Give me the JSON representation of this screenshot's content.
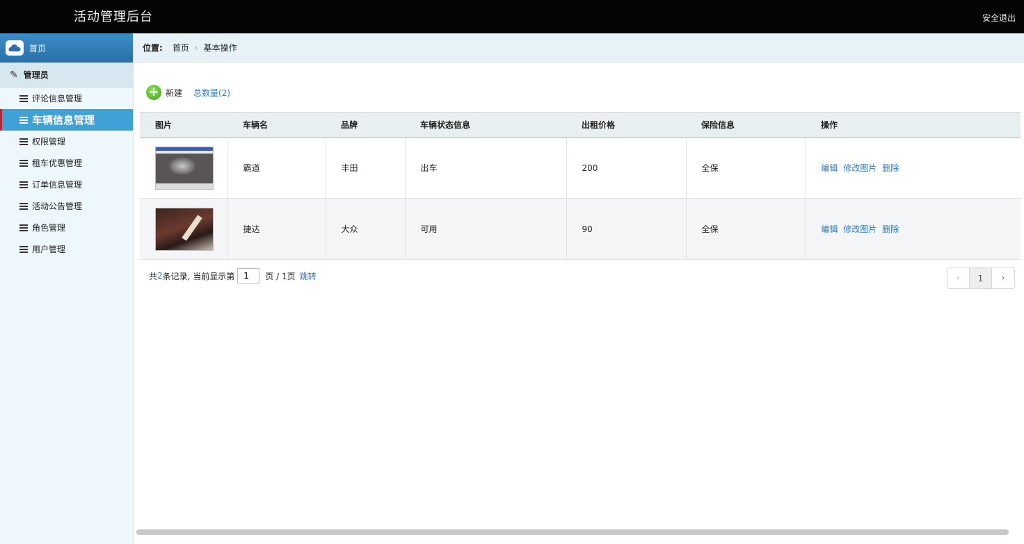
{
  "header": {
    "title": "活动管理后台",
    "logout_label": "安全退出"
  },
  "sidebar": {
    "home_label": "首页",
    "group_label": "管理员",
    "items": [
      {
        "label": "评论信息管理"
      },
      {
        "label": "车辆信息管理",
        "active": true
      },
      {
        "label": "权限管理"
      },
      {
        "label": "租车优惠管理"
      },
      {
        "label": "订单信息管理"
      },
      {
        "label": "活动公告管理"
      },
      {
        "label": "角色管理"
      },
      {
        "label": "用户管理"
      }
    ]
  },
  "breadcrumb": {
    "label": "位置:",
    "items": [
      "首页",
      "基本操作"
    ]
  },
  "toolbar": {
    "new_label": "新建",
    "total_label": "总数量(2)"
  },
  "table": {
    "columns": [
      "图片",
      "车辆名",
      "品牌",
      "车辆状态信息",
      "出租价格",
      "保险信息",
      "操作"
    ],
    "rows": [
      {
        "name": "霸道",
        "brand": "丰田",
        "status": "出车",
        "price": "200",
        "insurance": "全保"
      },
      {
        "name": "捷达",
        "brand": "大众",
        "status": "可用",
        "price": "90",
        "insurance": "全保"
      }
    ],
    "actions": {
      "edit": "编辑",
      "edit_image": "修改图片",
      "delete": "删除"
    }
  },
  "pager": {
    "prefix": "共",
    "count": "2",
    "suffix": "条记录,  当前显示第",
    "current_page": "1",
    "page_total_text": "页 / 1页",
    "jump_label": "跳转",
    "prev_symbol": "‹",
    "page_button": "1",
    "next_symbol": "›"
  },
  "colors": {
    "topbar": "#050505",
    "sidebar_active": "#3ea2d6",
    "link": "#2a7bc8",
    "active_marker": "#b52a3a"
  }
}
